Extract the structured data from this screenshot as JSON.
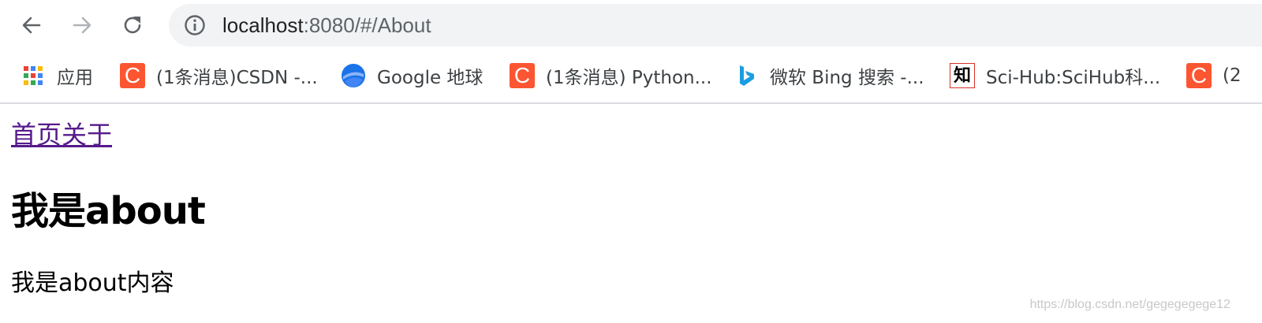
{
  "browser": {
    "url_host": "localhost",
    "url_rest": ":8080/#/About",
    "bookmarks": [
      {
        "label": "应用",
        "icon": "apps-grid-icon"
      },
      {
        "label": "(1条消息)CSDN -...",
        "icon": "csdn-icon"
      },
      {
        "label": "Google 地球",
        "icon": "google-earth-icon"
      },
      {
        "label": "(1条消息) Python...",
        "icon": "csdn-icon"
      },
      {
        "label": "微软 Bing 搜索 -...",
        "icon": "bing-icon"
      },
      {
        "label": "Sci-Hub:SciHub科...",
        "icon": "scihub-icon"
      },
      {
        "label": "(2",
        "icon": "csdn-icon"
      }
    ]
  },
  "page": {
    "nav_links": [
      "首页",
      "关于"
    ],
    "heading": "我是about",
    "content": "我是about内容",
    "watermark": "https://blog.csdn.net/gegegegege12"
  },
  "colors": {
    "csdn_red": "#fc5531",
    "visited_link": "#551a8b",
    "omnibox_bg": "#f1f3f4"
  }
}
